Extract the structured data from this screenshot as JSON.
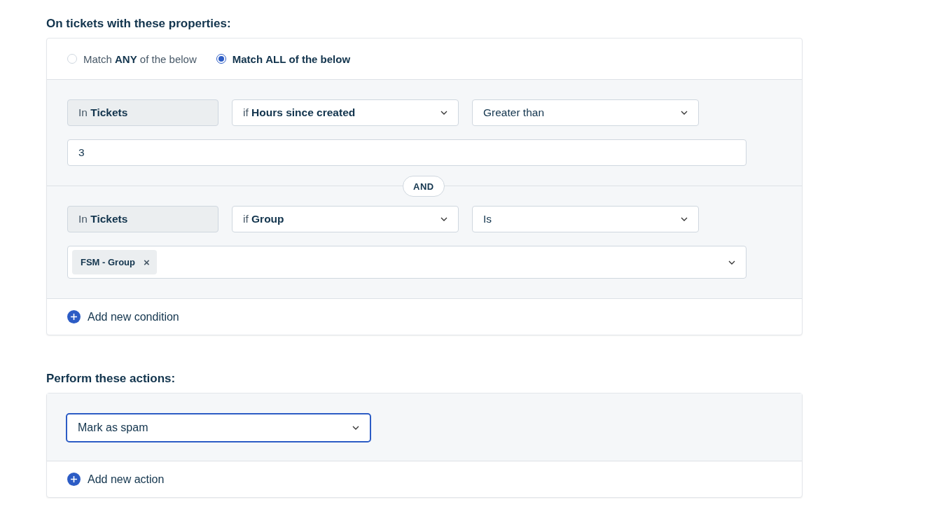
{
  "conditions_section": {
    "heading": "On tickets with these properties:",
    "match_options": [
      {
        "label": "Match **ANY** of the below",
        "selected": false
      },
      {
        "label": "Match **ALL** of the below",
        "selected": true
      }
    ],
    "conditions": [
      {
        "scope": "In **Tickets**",
        "field": "if **Hours since created**",
        "operator": "Greater than",
        "value": {
          "kind": "text",
          "text": "3"
        }
      },
      {
        "scope": "In **Tickets**",
        "field": "if **Group**",
        "operator": "Is",
        "value": {
          "kind": "tags",
          "tags": [
            "FSM - Group"
          ],
          "remove_icon": "×"
        }
      }
    ],
    "joiner": "AND",
    "add_button": "Add new condition"
  },
  "actions_section": {
    "heading": "Perform these actions:",
    "actions": [
      {
        "value": "Mark as spam",
        "focused": true
      }
    ],
    "add_button": "Add new action"
  }
}
